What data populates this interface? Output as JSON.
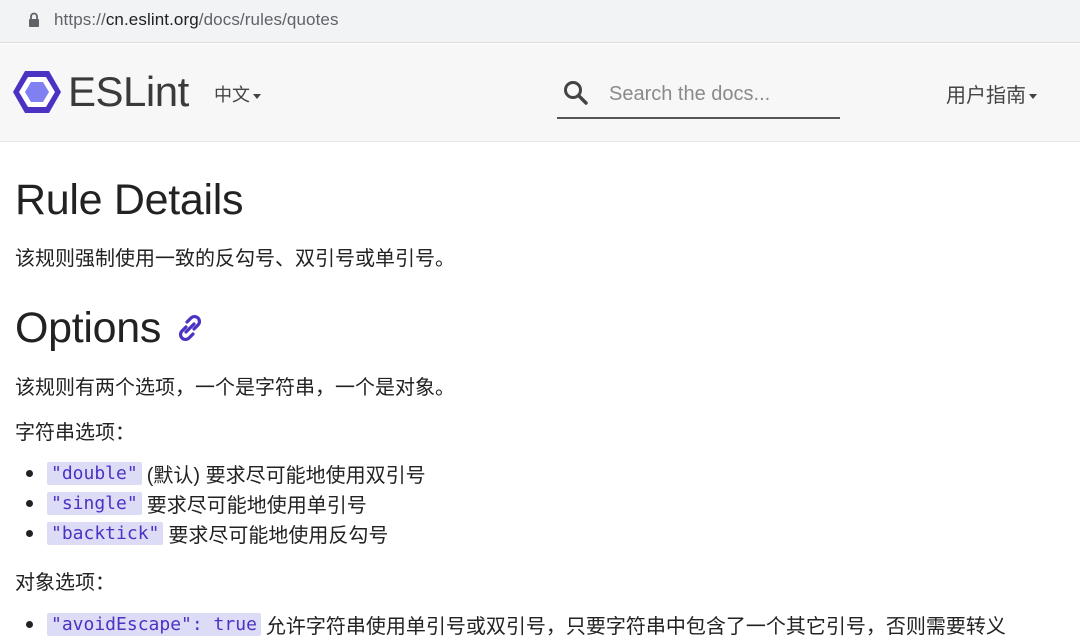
{
  "browser": {
    "url_prefix": "https://",
    "url_host": "cn.eslint.org",
    "url_path": "/docs/rules/quotes"
  },
  "header": {
    "logo_text": "ESLint",
    "language_label": "中文",
    "search_placeholder": "Search the docs...",
    "user_guide_label": "用户指南"
  },
  "content": {
    "rule_details_heading": "Rule Details",
    "rule_details_text": "该规则强制使用一致的反勾号、双引号或单引号。",
    "options_heading": "Options",
    "options_text": "该规则有两个选项，一个是字符串，一个是对象。",
    "string_options_label": "字符串选项：",
    "string_options": [
      {
        "code": "\"double\"",
        "desc": "(默认) 要求尽可能地使用双引号"
      },
      {
        "code": "\"single\"",
        "desc": "要求尽可能地使用单引号"
      },
      {
        "code": "\"backtick\"",
        "desc": "要求尽可能地使用反勾号"
      }
    ],
    "object_options_label": "对象选项：",
    "object_options": [
      {
        "code": "\"avoidEscape\": true",
        "desc": "允许字符串使用单引号或双引号，只要字符串中包含了一个其它引号，否则需要转义"
      }
    ]
  },
  "colors": {
    "brand": "#4b32c3",
    "code_bg": "#dcdcf7"
  }
}
